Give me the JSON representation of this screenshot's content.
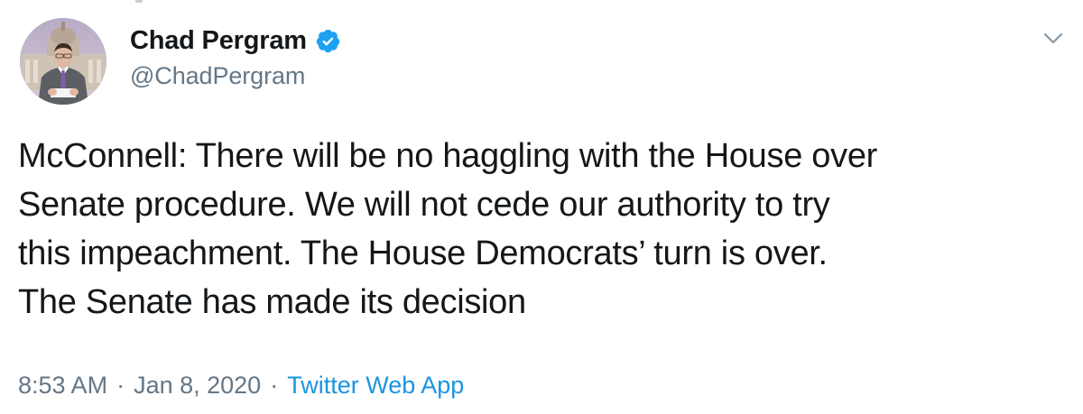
{
  "tweet": {
    "author": {
      "display_name": "Chad Pergram",
      "handle": "@ChadPergram",
      "verified": true,
      "avatar_icon": "profile-photo"
    },
    "text": "McConnell: There will be no haggling with the House over\nSenate procedure. We will not cede our authority to try\nthis impeachment. The House Democrats’ turn is over.\nThe Senate has made its decision",
    "time": "8:53 AM",
    "separator": "·",
    "date": "Jan 8, 2020",
    "source": "Twitter Web App",
    "menu_icon": "chevron-down-icon"
  },
  "colors": {
    "text": "#14171a",
    "secondary": "#657786",
    "link": "#1b95e0",
    "verified": "#1da1f2",
    "background": "#ffffff"
  }
}
